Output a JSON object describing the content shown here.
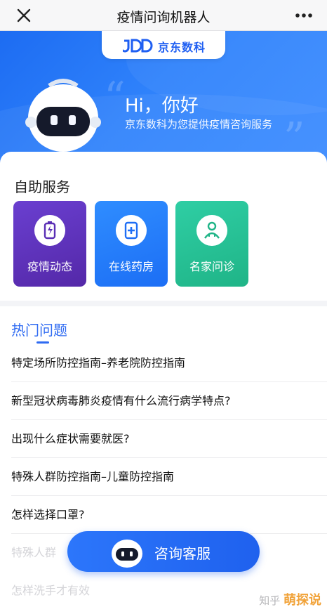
{
  "topbar": {
    "title": "疫情问询机器人"
  },
  "brand": {
    "name": "京东数科"
  },
  "hero": {
    "greeting": "Hi，你好",
    "subtitle": "京东数科为您提供疫情咨询服务"
  },
  "self_service": {
    "title": "自助服务",
    "items": [
      {
        "label": "疫情动态",
        "icon": "battery-bolt-icon"
      },
      {
        "label": "在线药房",
        "icon": "medical-kit-icon"
      },
      {
        "label": "名家问诊",
        "icon": "doctor-icon"
      }
    ]
  },
  "hot_questions": {
    "title": "热门问题",
    "items": [
      "特定场所防控指南–养老院防控指南",
      "新型冠状病毒肺炎疫情有什么流行病学特点?",
      "出现什么症状需要就医?",
      "特殊人群防控指南–儿童防控指南",
      "怎样选择口罩?",
      "特殊人群",
      "怎样洗手才有效"
    ]
  },
  "cs_button": {
    "label": "咨询客服"
  },
  "watermark": {
    "zhihu": "知乎",
    "site": "萌探说"
  },
  "colors": {
    "primary": "#1f61ee",
    "purple": "#5a2fb5",
    "green": "#22bf91"
  }
}
